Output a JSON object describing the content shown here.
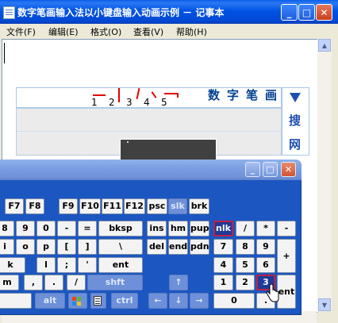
{
  "notepad": {
    "title": "数字笔画输入法以小键盘输入动画示例 － 记事本",
    "menus": [
      "文件(F)",
      "编辑(E)",
      "格式(O)",
      "查看(V)",
      "帮助(H)"
    ],
    "buttons": {
      "minimize": "_",
      "maximize": "□",
      "close": "✕"
    }
  },
  "ime": {
    "candidate_numbers": [
      "1",
      "2",
      "3",
      "4",
      "5"
    ],
    "title_chars": [
      "数",
      "字",
      "笔",
      "画"
    ],
    "search_label": "搜",
    "web_label": "网",
    "stroke_color": "#e00000",
    "accent_color": "#1e4fb0"
  },
  "osk": {
    "buttons": {
      "minimize": "_",
      "maximize": "□",
      "close": "✕"
    },
    "row_f": [
      "F7",
      "F8",
      "F9",
      "F10",
      "F11",
      "F12",
      "psc",
      "slk",
      "brk"
    ],
    "row_num": [
      "8",
      "9",
      "0",
      "-",
      "=",
      "bksp",
      "ins",
      "hm",
      "pup",
      "nlk",
      "/",
      "*",
      "-"
    ],
    "row_q": [
      "i",
      "o",
      "p",
      "[",
      "]",
      "\\",
      "del",
      "end",
      "pdn",
      "7",
      "8",
      "9",
      "+"
    ],
    "row_a": [
      "k",
      "l",
      ";",
      "'",
      "ent",
      "4",
      "5",
      "6"
    ],
    "row_z": [
      "m",
      ",",
      ".",
      "/",
      "shft",
      "↑",
      "1",
      "2",
      "3",
      "ent"
    ],
    "row_bottom": [
      "alt",
      "ctrl",
      "←",
      "↓",
      "→",
      "0",
      "."
    ],
    "active_color": "#c02040"
  }
}
